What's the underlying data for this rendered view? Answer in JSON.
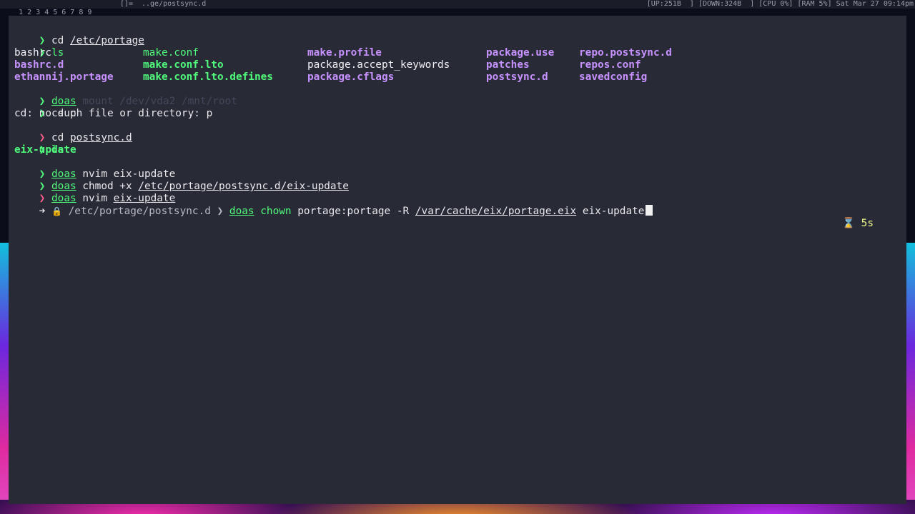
{
  "statusbar": {
    "workspaces": [
      "1",
      "2",
      "3",
      "4",
      "5",
      "6",
      "7",
      "8",
      "9"
    ],
    "layout": "[]=",
    "window_title": "..ge/postsync.d",
    "status": "[UP:251B  ] [DOWN:324B  ] [CPU 0%] [RAM 5%] Sat Mar 27 09:14pm"
  },
  "terminal": {
    "prompt_symbol": "❯",
    "lines": {
      "l1_cmd": "cd",
      "l1_arg": "/etc/portage",
      "l2_cmd": "ls",
      "ls1": {
        "r1": [
          "bashrc",
          "make.conf",
          "make.profile",
          "package.use",
          "repo.postsync.d"
        ],
        "r2": [
          "bashrc.d",
          "make.conf.lto",
          "package.accept_keywords",
          "patches",
          "repos.conf"
        ],
        "r3": [
          "ethannij.portage",
          "make.conf.lto.defines",
          "package.cflags",
          "postsync.d",
          "savedconfig"
        ]
      },
      "l6_cmd": "doas",
      "l6_rest": "mount /dev/vda2 /mnt/root",
      "l7_cmd": "cd p",
      "l8_out": "cd: no such file or directory: p",
      "l9_cmd": "cd",
      "l9_arg": "postsync.d",
      "l10_cmd": "ls",
      "l11_out": "eix-update",
      "l12_cmd": "doas",
      "l12_rest": "nvim eix-update",
      "l13_cmd": "doas",
      "l13_mid": "chmod +x",
      "l13_arg": "/etc/portage/postsync.d/eix-update",
      "l14_cmd": "doas",
      "l14_rest": "nvim",
      "l14_arg": "eix-update"
    },
    "current": {
      "arrow": "➜",
      "lock": "🔒",
      "cwd": "/etc/portage/postsync.d",
      "sep": "❯",
      "cmd": "doas",
      "sub": "chown",
      "owner": "portage:portage -R",
      "arg1": "/var/cache/eix/portage.eix",
      "arg2": "eix-update",
      "hourglass": "⌛",
      "elapsed": "5s"
    }
  }
}
